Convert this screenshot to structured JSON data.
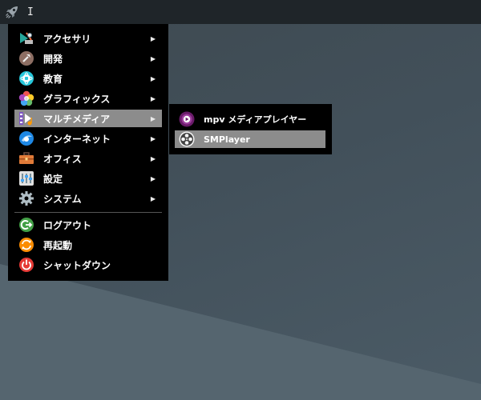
{
  "menu": {
    "items": [
      {
        "label": "アクセサリ",
        "icon": "accessories-icon",
        "has_submenu": true
      },
      {
        "label": "開発",
        "icon": "development-icon",
        "has_submenu": true
      },
      {
        "label": "教育",
        "icon": "education-icon",
        "has_submenu": true
      },
      {
        "label": "グラフィックス",
        "icon": "graphics-icon",
        "has_submenu": true
      },
      {
        "label": "マルチメディア",
        "icon": "multimedia-icon",
        "has_submenu": true,
        "active": true
      },
      {
        "label": "インターネット",
        "icon": "internet-icon",
        "has_submenu": true
      },
      {
        "label": "オフィス",
        "icon": "office-icon",
        "has_submenu": true
      },
      {
        "label": "設定",
        "icon": "settings-icon",
        "has_submenu": true
      },
      {
        "label": "システム",
        "icon": "system-icon",
        "has_submenu": true
      }
    ],
    "session": [
      {
        "label": "ログアウト",
        "icon": "logout-icon"
      },
      {
        "label": "再起動",
        "icon": "reboot-icon"
      },
      {
        "label": "シャットダウン",
        "icon": "shutdown-icon"
      }
    ],
    "arrow": "▶"
  },
  "submenu": {
    "items": [
      {
        "label": "mpv メディアプレイヤー",
        "icon": "mpv-icon"
      },
      {
        "label": "SMPlayer",
        "icon": "smplayer-icon",
        "active": true
      }
    ]
  },
  "panel": {
    "cursor_text": "I"
  },
  "colors": {
    "menu_bg": "#000000",
    "highlight": "#8c8c8c",
    "panel_bg": "#1f2529"
  }
}
